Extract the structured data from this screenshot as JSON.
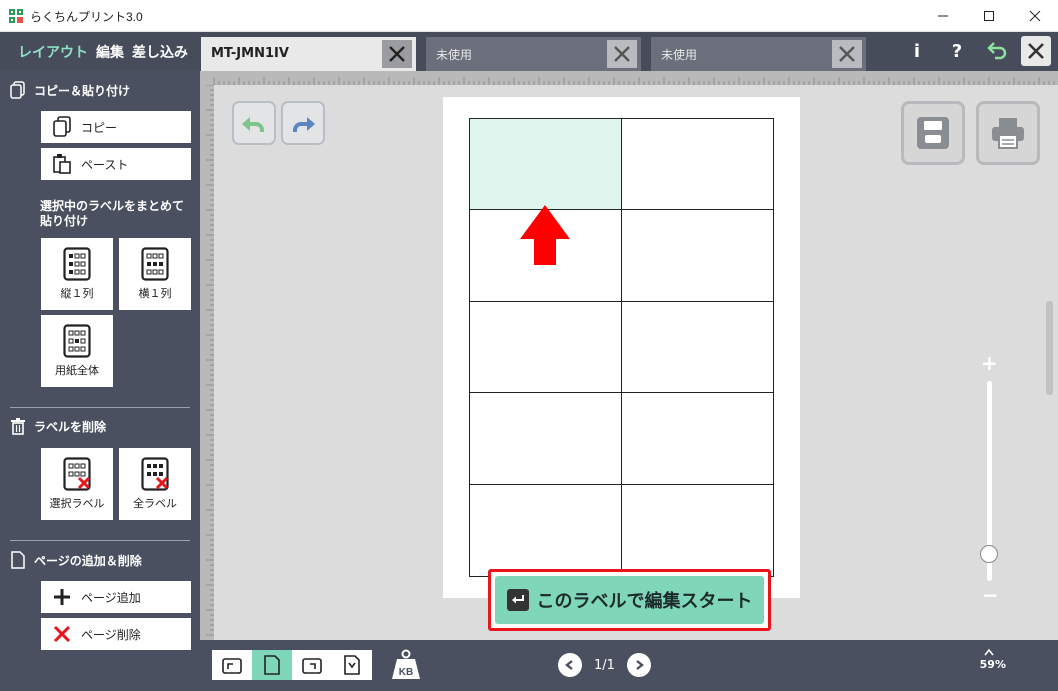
{
  "window": {
    "title": "らくちんプリント3.0"
  },
  "modes": {
    "layout": "レイアウト",
    "edit": "編集",
    "merge": "差し込み"
  },
  "tabs": [
    {
      "label": "MT-JMN1IV",
      "active": true
    },
    {
      "label": "未使用",
      "active": false
    },
    {
      "label": "未使用",
      "active": false
    }
  ],
  "top_icons": {
    "info": "i",
    "help": "?"
  },
  "sidebar": {
    "copy_paste": {
      "heading": "コピー＆貼り付け",
      "copy": "コピー",
      "paste": "ペースト",
      "bulk_heading": "選択中のラベルをまとめて 貼り付け",
      "tiles": [
        "縦１列",
        "横１列",
        "用紙全体"
      ]
    },
    "delete": {
      "heading": "ラベルを削除",
      "tiles": [
        "選択ラベル",
        "全ラベル"
      ]
    },
    "pages": {
      "heading": "ページの追加＆削除",
      "add": "ページ追加",
      "remove": "ページ削除"
    }
  },
  "canvas": {
    "start_button": "このラベルで編集スタート",
    "label_grid": {
      "columns": 2,
      "rows": 5,
      "selected_cell": 1
    }
  },
  "bottom": {
    "page": "1/1",
    "zoom": "59%",
    "kb_label": "KB",
    "active_orientation": 2
  },
  "colors": {
    "accent": "#7fd6b8",
    "sidebar": "#4a5060",
    "highlight_red": "#e8161b",
    "selected_cell": "#dff6ef"
  },
  "icons": [
    "app-icon",
    "copy-icon",
    "paste-icon",
    "trash-icon",
    "page-icon",
    "plus-icon",
    "x-icon",
    "undo-icon",
    "redo-icon",
    "save-icon",
    "print-icon",
    "enter-icon",
    "weight-kb-icon",
    "prev-icon",
    "next-icon"
  ]
}
